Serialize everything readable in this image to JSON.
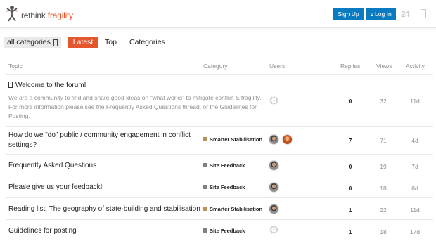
{
  "header": {
    "logo": {
      "part1": "rethink",
      "part2": "fragility"
    },
    "signup_label": "Sign Up",
    "login_label": "Log In",
    "login_icon": "lock-icon",
    "right_icons": [
      "24-icon",
      "menu-icon"
    ],
    "right_text": "24"
  },
  "nav": {
    "category_dropdown": "all categories",
    "tabs": [
      {
        "label": "Latest",
        "active": true
      },
      {
        "label": "Top",
        "active": false
      },
      {
        "label": "Categories",
        "active": false
      }
    ]
  },
  "table": {
    "headers": {
      "topic": "Topic",
      "category": "Category",
      "users": "Users",
      "replies": "Replies",
      "views": "Views",
      "activity": "Activity"
    },
    "rows": [
      {
        "title": "Welcome to the forum!",
        "pinned": true,
        "excerpt": "We are a community to find and share good ideas on \"what works\" to mitigate conflict & fragility. For more information please see the Frequently Asked Questions thread, or the Guidelines for Posting.",
        "category": "",
        "users": [
          "gear-icon"
        ],
        "replies": "0",
        "views": "32",
        "activity": "11d"
      },
      {
        "title": "How do we \"do\" public / community engagement in conflict settings?",
        "category": "Smarter Stabilisation",
        "category_color": "#b8925a",
        "users": [
          "avatar-man",
          "avatar-orange"
        ],
        "replies": "7",
        "views": "71",
        "activity": "4d"
      },
      {
        "title": "Frequently Asked Questions",
        "category": "Site Feedback",
        "category_color": "#808281",
        "users": [
          "avatar-man"
        ],
        "replies": "0",
        "views": "19",
        "activity": "7d"
      },
      {
        "title": "Please give us your feedback!",
        "category": "Site Feedback",
        "category_color": "#808281",
        "users": [
          "avatar-man"
        ],
        "replies": "0",
        "views": "18",
        "activity": "8d"
      },
      {
        "title": "Reading list: The geography of state-building and stabilisation",
        "category": "Smarter Stabilisation",
        "category_color": "#b8925a",
        "users": [
          "avatar-man"
        ],
        "replies": "1",
        "views": "22",
        "activity": "11d"
      },
      {
        "title": "Guidelines for posting",
        "category": "Site Feedback",
        "category_color": "#808281",
        "users": [
          "gear-icon"
        ],
        "replies": "1",
        "views": "18",
        "activity": "17d"
      }
    ]
  },
  "colors": {
    "accent": "#e4572e",
    "button_blue": "#0b7bc1"
  }
}
